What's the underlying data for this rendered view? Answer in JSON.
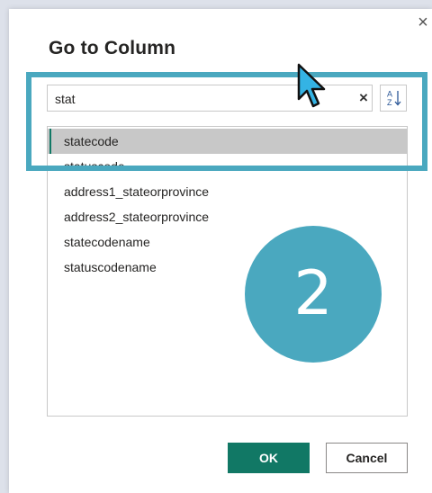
{
  "dialog": {
    "title": "Go to Column",
    "close_glyph": "×"
  },
  "search": {
    "value": "stat",
    "clear_glyph": "×"
  },
  "sort_button": {
    "icon": "sort-az-icon",
    "letter_top": "A",
    "letter_bottom": "Z"
  },
  "columns": {
    "items": [
      "statecode",
      "statuscode",
      "address1_stateorprovince",
      "address2_stateorprovince",
      "statecodename",
      "statuscodename"
    ],
    "selected": "statecode"
  },
  "buttons": {
    "ok_label": "OK",
    "cancel_label": "Cancel"
  },
  "annotation": {
    "step_number": "2"
  },
  "colors": {
    "accent": "#117865",
    "annotation": "#4aa8bf",
    "selected_row": "#c8c8c8"
  }
}
